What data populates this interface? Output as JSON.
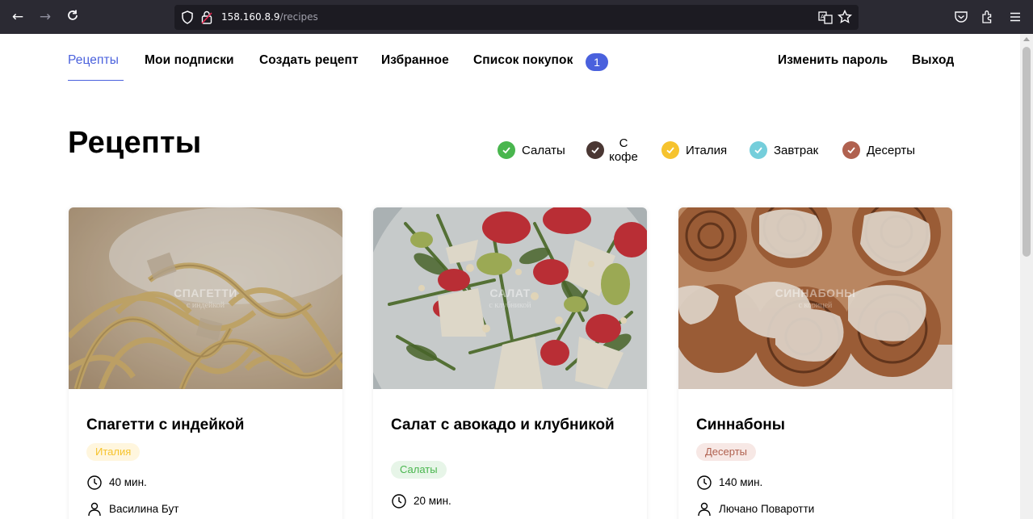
{
  "browser": {
    "url_host": "158.160.8.9",
    "url_path": "/recipes"
  },
  "nav": {
    "recipes": "Рецепты",
    "subscriptions": "Мои подписки",
    "create": "Создать рецепт",
    "favorites": "Избранное",
    "shopping": "Список покупок",
    "shopping_count": "1",
    "change_password": "Изменить пароль",
    "logout": "Выход"
  },
  "page": {
    "title": "Рецепты"
  },
  "tags": [
    {
      "label": "Салаты",
      "color": "#49b64e"
    },
    {
      "label": "С кофе",
      "color": "#4a3733"
    },
    {
      "label": "Италия",
      "color": "#f6c32e"
    },
    {
      "label": "Завтрак",
      "color": "#75cedb"
    },
    {
      "label": "Десерты",
      "color": "#b0614f"
    }
  ],
  "recipes": [
    {
      "overlay_title": "СПАГЕТТИ",
      "overlay_sub": "с индейкой",
      "name": "Спагетти с индейкой",
      "tag": "Италия",
      "tag_color": "#f6c32e",
      "time": "40 мин.",
      "author": "Василина Бут"
    },
    {
      "overlay_title": "САЛАТ",
      "overlay_sub": "с клубникой",
      "name": "Салат с авокадо и клубникой",
      "tag": "Салаты",
      "tag_color": "#49b64e",
      "time": "20 мин.",
      "author": ""
    },
    {
      "overlay_title": "СИННАБОНЫ",
      "overlay_sub": "с корицей",
      "name": "Синнабоны",
      "tag": "Десерты",
      "tag_color": "#b0614f",
      "time": "140 мин.",
      "author": "Лючано Поваротти"
    }
  ]
}
